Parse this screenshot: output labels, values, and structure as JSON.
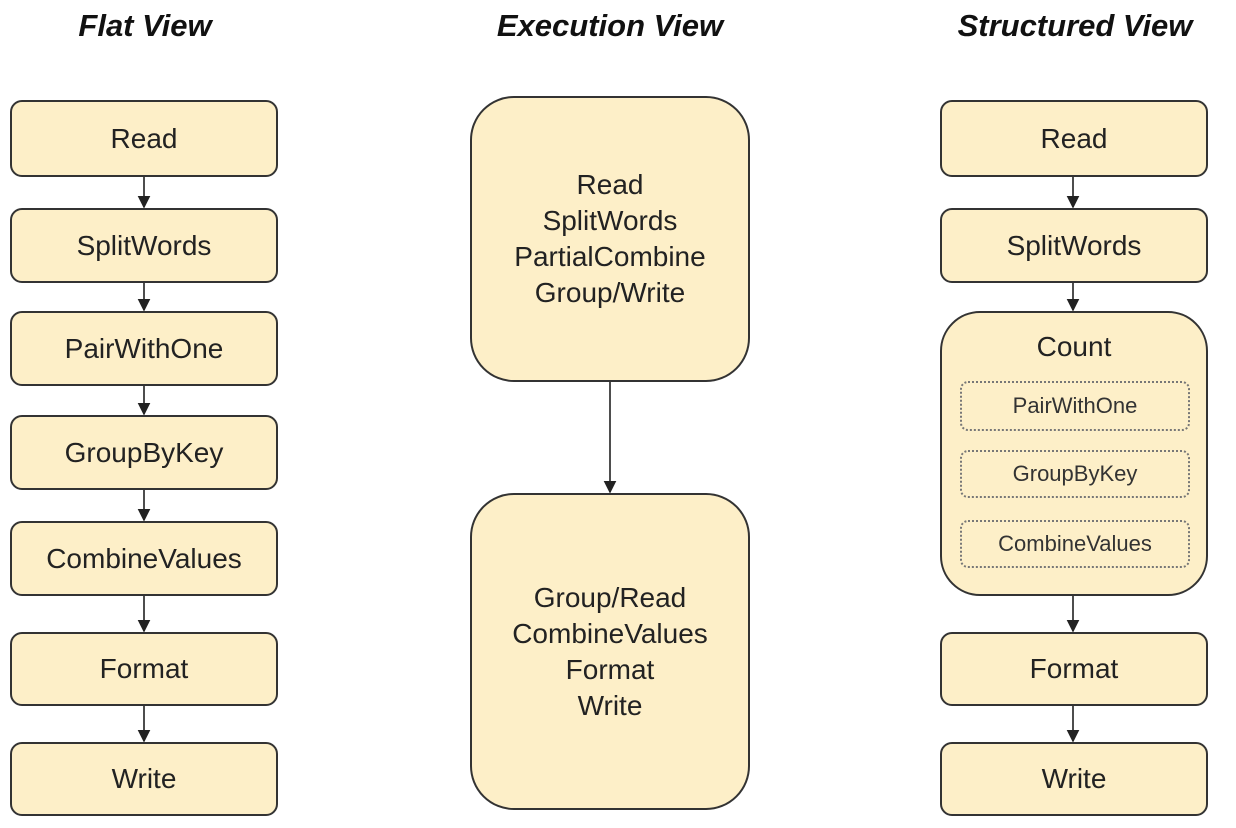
{
  "columns": {
    "flat": {
      "title": "Flat View",
      "nodes": [
        "Read",
        "SplitWords",
        "PairWithOne",
        "GroupByKey",
        "CombineValues",
        "Format",
        "Write"
      ]
    },
    "execution": {
      "title": "Execution View",
      "stages": [
        [
          "Read",
          "SplitWords",
          "PartialCombine",
          "Group/Write"
        ],
        [
          "Group/Read",
          "CombineValues",
          "Format",
          "Write"
        ]
      ]
    },
    "structured": {
      "title": "Structured View",
      "nodes": [
        "Read",
        "SplitWords",
        "Format",
        "Write"
      ],
      "composite": {
        "label": "Count",
        "children": [
          "PairWithOne",
          "GroupByKey",
          "CombineValues"
        ]
      }
    }
  }
}
